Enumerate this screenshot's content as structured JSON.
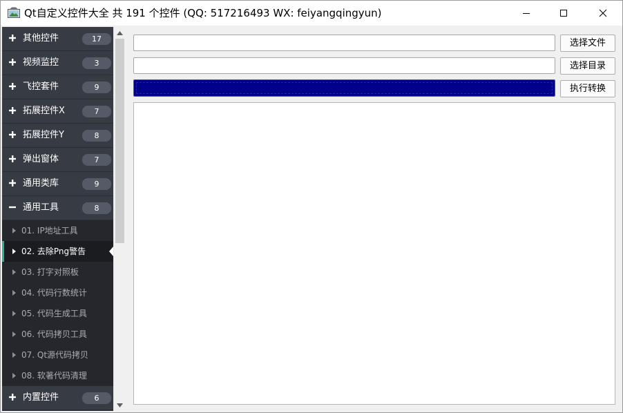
{
  "window": {
    "title": "Qt自定义控件大全 共 191 个控件 (QQ: 517216493 WX: feiyangqingyun)",
    "icon": "app-image-icon",
    "controls": [
      "minimize-icon",
      "maximize-icon",
      "close-icon"
    ]
  },
  "sidebar": {
    "groups": [
      {
        "label": "其他控件",
        "count": "17",
        "expanded": false
      },
      {
        "label": "视频监控",
        "count": "3",
        "expanded": false
      },
      {
        "label": "飞控套件",
        "count": "9",
        "expanded": false
      },
      {
        "label": "拓展控件X",
        "count": "7",
        "expanded": false
      },
      {
        "label": "拓展控件Y",
        "count": "8",
        "expanded": false
      },
      {
        "label": "弹出窗体",
        "count": "7",
        "expanded": false
      },
      {
        "label": "通用类库",
        "count": "9",
        "expanded": false
      },
      {
        "label": "通用工具",
        "count": "8",
        "expanded": true
      },
      {
        "label": "内置控件",
        "count": "6",
        "expanded": false
      }
    ],
    "items": [
      {
        "label": "01. IP地址工具"
      },
      {
        "label": "02. 去除Png警告",
        "selected": true
      },
      {
        "label": "03. 打字对照板"
      },
      {
        "label": "04. 代码行数统计"
      },
      {
        "label": "05. 代码生成工具"
      },
      {
        "label": "06. 代码拷贝工具"
      },
      {
        "label": "07. Qt源代码拷贝"
      },
      {
        "label": "08. 软著代码清理"
      }
    ],
    "colors": {
      "accent": "#26b290",
      "group_bg": "#373b43",
      "item_bg": "#25272d"
    }
  },
  "main": {
    "file_input": {
      "value": ""
    },
    "dir_input": {
      "value": ""
    },
    "select_file_label": "选择文件",
    "select_dir_label": "选择目录",
    "execute_label": "执行转换",
    "progress": {
      "percent": 100,
      "color": "#00008b"
    },
    "output": {
      "text": ""
    }
  }
}
